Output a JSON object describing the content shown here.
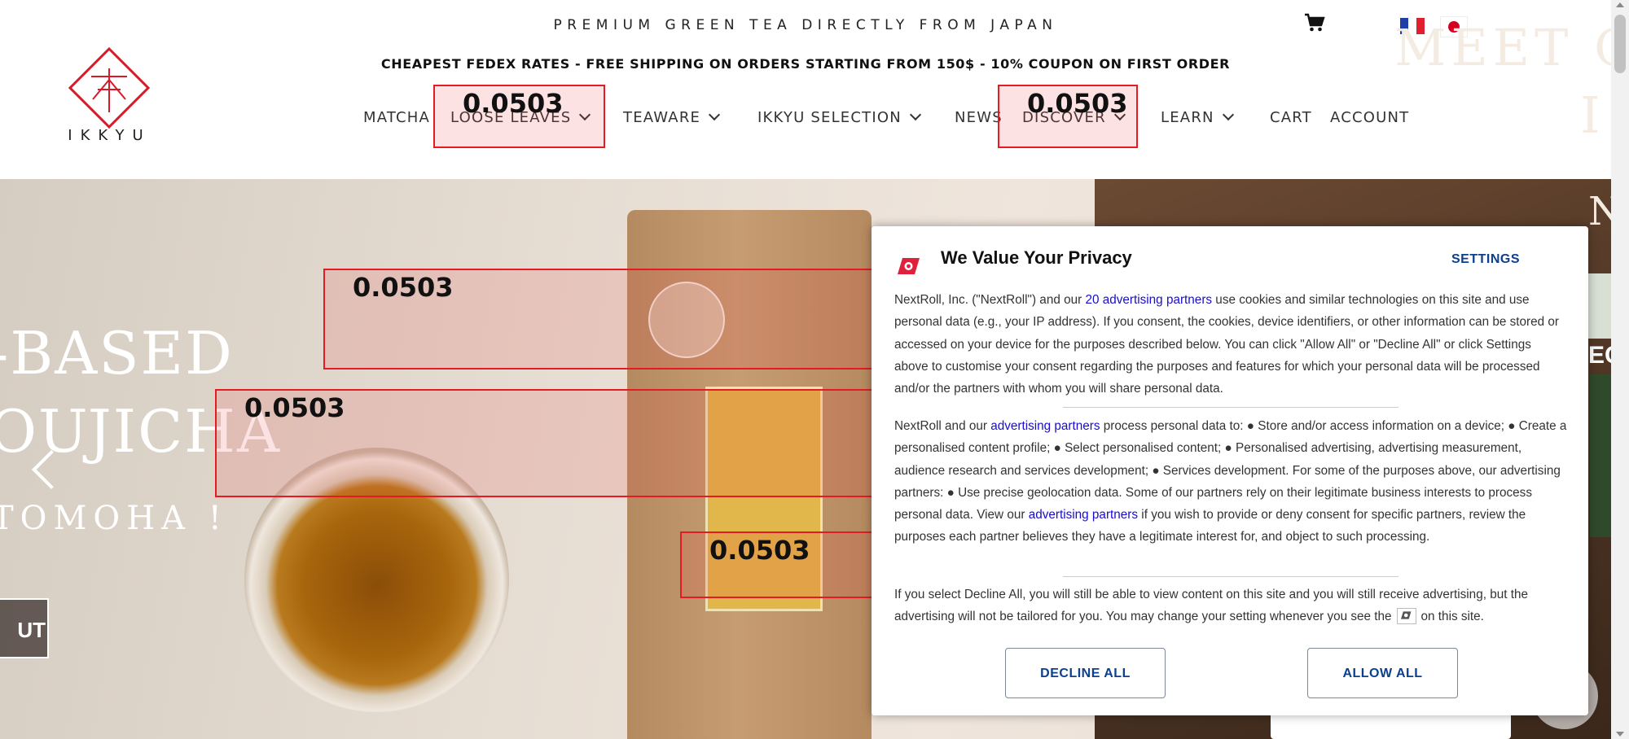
{
  "header": {
    "tagline": "PREMIUM GREEN TEA DIRECTLY FROM JAPAN",
    "shipping_banner": "CHEAPEST FEDEX RATES - FREE SHIPPING ON ORDERS STARTING FROM 150$ - 10% COUPON ON FIRST ORDER",
    "logo_text": "IKKYU",
    "cart_icon": "cart-icon",
    "languages": [
      "french-flag-icon",
      "japanese-flag-icon"
    ]
  },
  "nav": {
    "items": [
      {
        "label": "MATCHA",
        "dropdown": false
      },
      {
        "label": "LOOSE LEAVES",
        "dropdown": true
      },
      {
        "label": "TEAWARE",
        "dropdown": true
      },
      {
        "label": "IKKYU SELECTION",
        "dropdown": true
      },
      {
        "label": "NEWS",
        "dropdown": false
      },
      {
        "label": "DISCOVER",
        "dropdown": true
      },
      {
        "label": "LEARN",
        "dropdown": true
      },
      {
        "label": "CART",
        "dropdown": false
      },
      {
        "label": "ACCOUNT",
        "dropdown": false
      }
    ]
  },
  "hero": {
    "line1": "-BASED",
    "line2": "OUJICHA",
    "line3": "TOMOHA !",
    "button": "UT",
    "right_heading": "MEET O",
    "right_letter_i": "I",
    "right_letter_n": "N",
    "right_ec": "EC"
  },
  "annotations": {
    "scores": [
      "0.0503",
      "0.0503",
      "0.0503",
      "0.0503",
      "0.0503"
    ],
    "color": "#e41b23"
  },
  "cookie_modal": {
    "title": "We Value Your Privacy",
    "settings_label": "SETTINGS",
    "para1_pre": "NextRoll, Inc. (\"NextRoll\") and our ",
    "para1_link": "20 advertising partners",
    "para1_post": " use cookies and similar technologies on this site and use personal data (e.g., your IP address). If you consent, the cookies, device identifiers, or other information can be stored or accessed on your device for the purposes described below. You can click \"Allow All\" or \"Decline All\" or click Settings above to customise your consent regarding the purposes and features for which your personal data will be processed and/or the partners with whom you will share personal data.",
    "para2_pre": "NextRoll and our ",
    "para2_link1": "advertising partners",
    "para2_mid": " process personal data to: ● Store and/or access information on a device; ● Create a personalised content profile; ● Select personalised content; ● Personalised advertising, advertising measurement, audience research and services development; ● Services development. For some of the purposes above, our advertising partners: ● Use precise geolocation data. Some of our partners rely on their legitimate business interests to process personal data. View our ",
    "para2_link2": "advertising partners",
    "para2_post": " if you wish to provide or deny consent for specific partners, review the purposes each partner believes they have a legitimate interest for, and object to such processing.",
    "para3_pre": "If you select Decline All, you will still be able to view content on this site and you will still receive advertising, but the advertising will not be tailored for you. You may change your setting whenever you see the",
    "para3_post": "on this site.",
    "decline_label": "DECLINE ALL",
    "allow_label": "ALLOW ALL",
    "accent_color": "#0b3f8f",
    "link_color": "#1a0dcc",
    "logo_color": "#e0213c"
  }
}
